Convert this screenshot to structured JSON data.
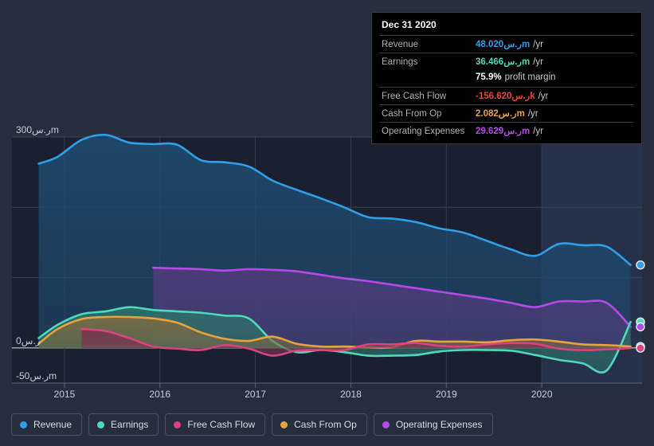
{
  "tooltip": {
    "date": "Dec 31 2020",
    "rows": [
      {
        "label": "Revenue",
        "value": "48.020ر.سm",
        "suffix": "/yr",
        "color": "#2f9eea"
      },
      {
        "label": "Earnings",
        "value": "36.466ر.سm",
        "suffix": "/yr",
        "color": "#4fd9bc"
      },
      {
        "label": "",
        "value": "75.9%",
        "suffix": "profit margin",
        "color": "#ffffff"
      },
      {
        "label": "Free Cash Flow",
        "value": "-156.620ر.سk",
        "suffix": "/yr",
        "color": "#e8453c"
      },
      {
        "label": "Cash From Op",
        "value": "2.082ر.سm",
        "suffix": "/yr",
        "color": "#e8a33d"
      },
      {
        "label": "Operating Expenses",
        "value": "29.629ر.سm",
        "suffix": "/yr",
        "color": "#b44ae8"
      }
    ]
  },
  "legend": {
    "items": [
      {
        "label": "Revenue",
        "color": "#2f9eea"
      },
      {
        "label": "Earnings",
        "color": "#4fd9bc"
      },
      {
        "label": "Free Cash Flow",
        "color": "#d8457e"
      },
      {
        "label": "Cash From Op",
        "color": "#e8a33d"
      },
      {
        "label": "Operating Expenses",
        "color": "#b44ae8"
      }
    ]
  },
  "chart_data": {
    "type": "area",
    "title": "",
    "xlabel": "",
    "ylabel": "",
    "ylim": [
      -50,
      300
    ],
    "xlim": [
      2014.45,
      2021.05
    ],
    "grid": true,
    "legend_position": "bottom",
    "y_ticks": [
      {
        "value": 300,
        "label": "300ر.سm"
      },
      {
        "value": 200,
        "label": ""
      },
      {
        "value": 100,
        "label": ""
      },
      {
        "value": 0,
        "label": "0ر.س"
      },
      {
        "value": -50,
        "label": "-50ر.سm"
      }
    ],
    "x_ticks": [
      {
        "value": 2015,
        "label": "2015"
      },
      {
        "value": 2016,
        "label": "2016"
      },
      {
        "value": 2017,
        "label": "2017"
      },
      {
        "value": 2018,
        "label": "2018"
      },
      {
        "value": 2019,
        "label": "2019"
      },
      {
        "value": 2020,
        "label": "2020"
      }
    ],
    "highlight_band": {
      "from": 2020.0,
      "to": 2021.05
    },
    "series": [
      {
        "name": "Revenue",
        "color": "#2f9eea",
        "fill": "#1f4a6e",
        "x": [
          2014.73,
          2014.93,
          2015.18,
          2015.43,
          2015.68,
          2015.93,
          2016.18,
          2016.43,
          2016.68,
          2016.93,
          2017.18,
          2017.43,
          2017.68,
          2017.93,
          2018.18,
          2018.43,
          2018.68,
          2018.93,
          2019.18,
          2019.43,
          2019.68,
          2019.93,
          2020.18,
          2020.43,
          2020.68,
          2020.93
        ],
        "values": [
          262,
          272,
          296,
          303,
          292,
          290,
          289,
          267,
          264,
          258,
          238,
          225,
          213,
          200,
          186,
          184,
          179,
          170,
          164,
          152,
          140,
          131,
          148,
          146,
          144,
          118
        ]
      },
      {
        "name": "Earnings",
        "color": "#4fd9bc",
        "fill": "#2f6f68",
        "x": [
          2014.73,
          2014.93,
          2015.18,
          2015.43,
          2015.68,
          2015.93,
          2016.18,
          2016.43,
          2016.68,
          2016.93,
          2017.18,
          2017.43,
          2017.68,
          2017.93,
          2018.18,
          2018.43,
          2018.68,
          2018.93,
          2019.18,
          2019.43,
          2019.68,
          2019.93,
          2020.18,
          2020.43,
          2020.68,
          2020.93
        ],
        "values": [
          14,
          33,
          48,
          52,
          58,
          54,
          52,
          50,
          46,
          42,
          10,
          -6,
          -3,
          -6,
          -11,
          -11,
          -10,
          -5,
          -3,
          -3,
          -4,
          -10,
          -17,
          -22,
          -32,
          37
        ]
      },
      {
        "name": "Free Cash Flow",
        "color": "#d8457e",
        "fill": "#7a3550",
        "x": [
          2015.18,
          2015.43,
          2015.68,
          2015.93,
          2016.18,
          2016.43,
          2016.68,
          2016.93,
          2017.18,
          2017.43,
          2017.68,
          2017.93,
          2018.18,
          2018.43,
          2018.68,
          2018.93,
          2019.18,
          2019.43,
          2019.68,
          2019.93,
          2020.18,
          2020.43,
          2020.68,
          2020.93
        ],
        "values": [
          27,
          24,
          14,
          2,
          -1,
          -3,
          4,
          -1,
          -11,
          -4,
          -3,
          -3,
          5,
          5,
          7,
          3,
          2,
          5,
          7,
          6,
          -1,
          -3,
          -2,
          -0.2
        ]
      },
      {
        "name": "Cash From Op",
        "color": "#e8a33d",
        "fill": "#7a6a42",
        "x": [
          2014.73,
          2014.93,
          2015.18,
          2015.43,
          2015.68,
          2015.93,
          2016.18,
          2016.43,
          2016.68,
          2016.93,
          2017.18,
          2017.43,
          2017.68,
          2017.93,
          2018.18,
          2018.43,
          2018.68,
          2018.93,
          2019.18,
          2019.43,
          2019.68,
          2019.93,
          2020.18,
          2020.43,
          2020.68,
          2020.93
        ],
        "values": [
          6,
          27,
          41,
          44,
          44,
          42,
          36,
          22,
          13,
          10,
          16,
          6,
          2,
          2,
          1,
          1,
          10,
          9,
          9,
          8,
          11,
          12,
          9,
          5,
          4,
          2
        ]
      },
      {
        "name": "Operating Expenses",
        "color": "#b44ae8",
        "fill": "#4e3c7a",
        "x": [
          2015.93,
          2016.18,
          2016.43,
          2016.68,
          2016.93,
          2017.18,
          2017.43,
          2017.68,
          2017.93,
          2018.18,
          2018.43,
          2018.68,
          2018.93,
          2019.18,
          2019.43,
          2019.68,
          2019.93,
          2020.18,
          2020.43,
          2020.68,
          2020.93
        ],
        "values": [
          114,
          113,
          112,
          110,
          112,
          111,
          109,
          104,
          99,
          95,
          90,
          85,
          80,
          75,
          70,
          64,
          58,
          66,
          66,
          64,
          30
        ]
      }
    ],
    "end_markers": [
      {
        "name": "Revenue",
        "color": "#2f9eea",
        "value": 118
      },
      {
        "name": "Earnings",
        "color": "#4fd9bc",
        "value": 37
      },
      {
        "name": "Operating Expenses",
        "color": "#b44ae8",
        "value": 30
      },
      {
        "name": "Cash From Op",
        "color": "#e8a33d",
        "value": 2
      },
      {
        "name": "Free Cash Flow",
        "color": "#d8457e",
        "value": -0.2
      }
    ]
  }
}
